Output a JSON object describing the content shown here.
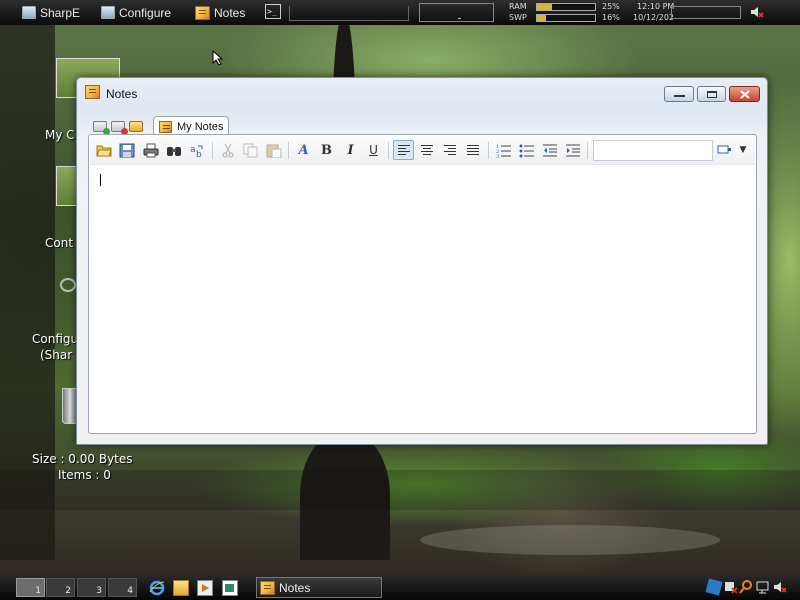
{
  "topbar": {
    "start_label": "SharpE",
    "configure_label": "Configure",
    "notes_label": "Notes",
    "terminal_glyph": ">_",
    "ram_label": "RAM",
    "ram_percent": "25%",
    "ram_fraction": 0.25,
    "swap_label": "SWP",
    "swap_percent": "16%",
    "swap_fraction": 0.16,
    "time": "12:10 PM",
    "date": "10/12/202"
  },
  "desktop": {
    "icon_labels": [
      "My C",
      "Cont",
      "Configu",
      "(Shar"
    ],
    "recycle_size": "Size : 0.00 Bytes",
    "recycle_items": "Items : 0"
  },
  "window": {
    "title": "Notes",
    "tab_label": "My Notes",
    "toolbar_icons": [
      "new-note-icon",
      "save-icon",
      "print-icon",
      "find-icon",
      "replace-icon",
      "cut-icon",
      "copy-icon",
      "paste-icon",
      "font-icon",
      "bold-icon",
      "italic-icon",
      "underline-icon",
      "align-left-icon",
      "align-center-icon",
      "align-right-icon",
      "justify-icon",
      "numbered-list-icon",
      "bullet-list-icon",
      "outdent-icon",
      "indent-icon"
    ],
    "bold_glyph": "B",
    "italic_glyph": "I",
    "underline_glyph": "U",
    "font_glyph": "A",
    "font_combo_value": ""
  },
  "taskbar": {
    "workspaces": [
      "1",
      "2",
      "3",
      "4"
    ],
    "active_workspace": "1",
    "task_label": "Notes"
  },
  "colors": {
    "accent": "#d7b43a",
    "close_button": "#c4442c",
    "window_frame": "#7d8ea4"
  }
}
